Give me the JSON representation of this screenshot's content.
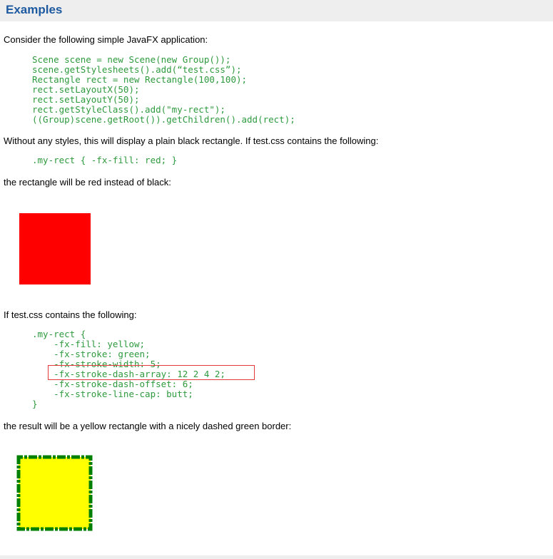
{
  "section": {
    "title": "Examples"
  },
  "text": {
    "intro": "Consider the following simple JavaFX application:",
    "no_styles": "Without any styles, this will display a plain black rectangle. If test.css contains the following:",
    "red_result": "the rectangle will be red instead of black:",
    "if_contains": "If test.css contains the following:",
    "yellow_result": "the result will be a yellow rectangle with a nicely dashed green border:"
  },
  "code": {
    "java": [
      "Scene scene = new Scene(new Group());",
      "scene.getStylesheets().add(“test.css”);",
      "Rectangle rect = new Rectangle(100,100);",
      "rect.setLayoutX(50);",
      "rect.setLayoutY(50);",
      "rect.getStyleClass().add(\"my-rect\");",
      "((Group)scene.getRoot()).getChildren().add(rect);"
    ],
    "css_red": ".my-rect { -fx-fill: red; }",
    "css_yellow": [
      ".my-rect {",
      "    -fx-fill: yellow;",
      "    -fx-stroke: green;",
      "    -fx-stroke-width: 5;",
      "    -fx-stroke-dash-array: 12 2 4 2;",
      "    -fx-stroke-dash-offset: 6;",
      "    -fx-stroke-line-cap: butt;",
      "}"
    ]
  },
  "colors": {
    "header_title": "#1e5aa0",
    "code_text": "#2e9a3e",
    "red_fill": "#ff0000",
    "yellow_fill": "#ffff00",
    "dash_stroke": "#008000",
    "highlight_border": "#e23a3a"
  }
}
